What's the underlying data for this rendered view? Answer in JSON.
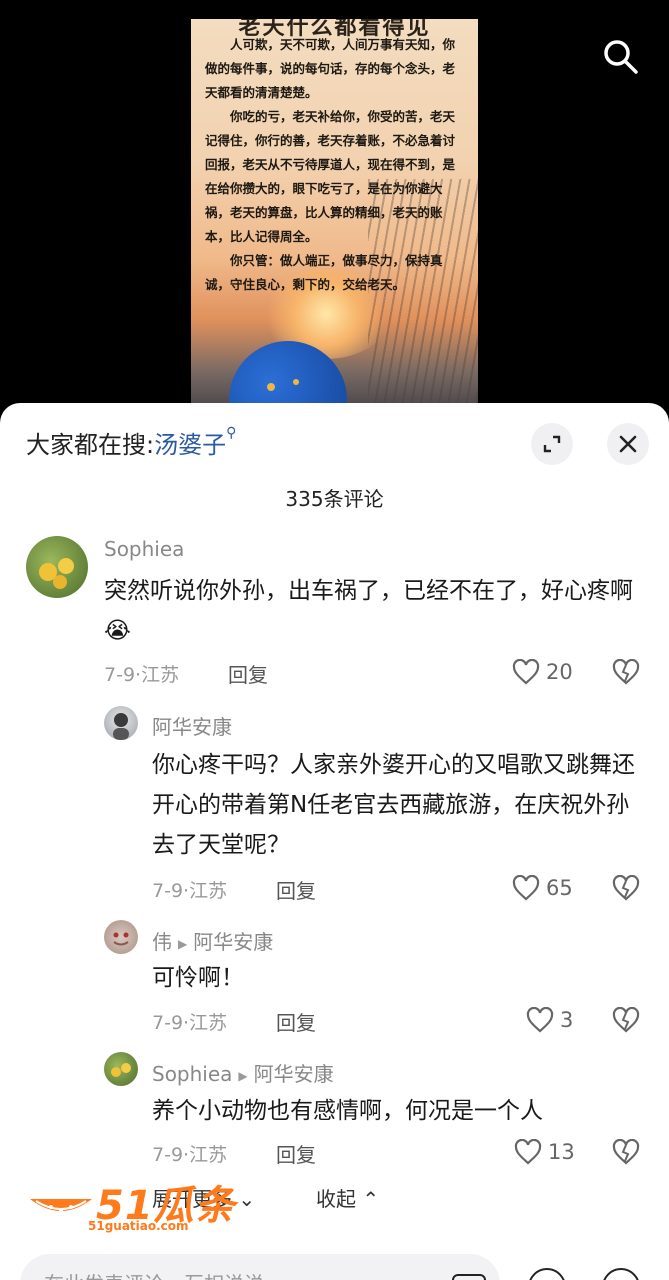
{
  "video": {
    "poster_headline": "老天什么都看得见",
    "poster_paragraphs": [
      "人可欺，天不可欺，人间万事有天知，你做的每件事，说的每句话，存的每个念头，老天都看的清清楚楚。",
      "你吃的亏，老天补给你，你受的苦，老天记得住，你行的善，老天存着账，不必急着讨回报，老天从不亏待厚道人，现在得不到，是在给你攒大的，眼下吃亏了，是在为你避大祸，老天的算盘，比人算的精细，老天的账本，比人记得周全。",
      "你只管：做人端正，做事尽力，保持真诚，守住良心，剩下的，交给老天。"
    ]
  },
  "header": {
    "hot_search_prefix": "大家都在搜:",
    "hot_search_keyword": "汤婆子",
    "comment_count": "335条评论"
  },
  "comments": [
    {
      "name": "Sophiea",
      "text": "突然听说你外孙，出车祸了，已经不在了，好心疼啊😭",
      "date_loc": "7-9·江苏",
      "reply_label": "回复",
      "likes": "20"
    },
    {
      "name": "阿华安康",
      "text": "你心疼干吗？人家亲外婆开心的又唱歌又跳舞还开心的带着第N任老官去西藏旅游，在庆祝外孙去了天堂呢？",
      "date_loc": "7-9·江苏",
      "reply_label": "回复",
      "likes": "65"
    },
    {
      "name": "伟",
      "reply_to": "阿华安康",
      "text": "可怜啊！",
      "date_loc": "7-9·江苏",
      "reply_label": "回复",
      "likes": "3"
    },
    {
      "name": "Sophiea",
      "reply_to": "阿华安康",
      "text": "养个小动物也有感情啊，何况是一个人",
      "date_loc": "7-9·江苏",
      "reply_label": "回复",
      "likes": "13"
    }
  ],
  "footer": {
    "expand_more": "展开更多",
    "collapse": "收起",
    "input_placeholder": "在此发表评论，互相说说"
  },
  "watermark": {
    "brand": "51瓜条",
    "url": "51guatiao.com"
  },
  "colors": {
    "keyword": "#2c5aa0",
    "watermark": "#ff7a1a"
  }
}
